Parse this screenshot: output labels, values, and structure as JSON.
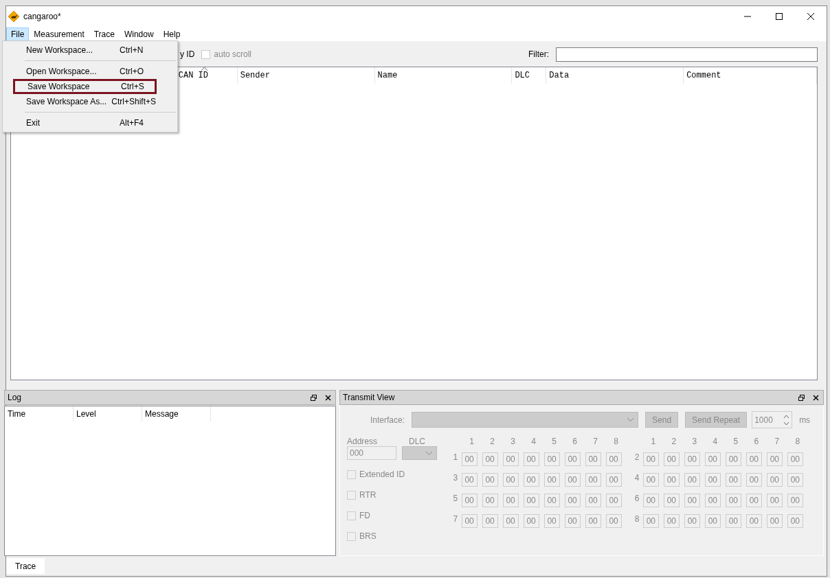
{
  "window": {
    "title": "cangaroo*"
  },
  "menubar": [
    {
      "label": "File",
      "selected": true
    },
    {
      "label": "Measurement",
      "selected": false
    },
    {
      "label": "Trace",
      "selected": false
    },
    {
      "label": "Window",
      "selected": false
    },
    {
      "label": "Help",
      "selected": false
    }
  ],
  "file_menu": {
    "items": [
      {
        "kind": "item",
        "label": "New Workspace...",
        "shortcut": "Ctrl+N",
        "highlighted": false
      },
      {
        "kind": "separator"
      },
      {
        "kind": "item",
        "label": "Open Workspace...",
        "shortcut": "Ctrl+O",
        "highlighted": false
      },
      {
        "kind": "item",
        "label": "Save Workspace",
        "shortcut": "Ctrl+S",
        "highlighted": true
      },
      {
        "kind": "item",
        "label": "Save Workspace As...",
        "shortcut": "Ctrl+Shift+S",
        "highlighted": false
      },
      {
        "kind": "separator"
      },
      {
        "kind": "item",
        "label": "Exit",
        "shortcut": "Alt+F4",
        "highlighted": false
      }
    ]
  },
  "trace_toolbar": {
    "aggregate_label": "y ID",
    "auto_scroll": {
      "label": "auto scroll",
      "checked": false
    },
    "filter_label": "Filter:"
  },
  "trace_table": {
    "columns": [
      {
        "label": "CAN ID",
        "sorted": true
      },
      {
        "label": "Sender",
        "sorted": false
      },
      {
        "label": "Name",
        "sorted": false
      },
      {
        "label": "DLC",
        "sorted": false
      },
      {
        "label": "Data",
        "sorted": false
      },
      {
        "label": "Comment",
        "sorted": false
      }
    ]
  },
  "log": {
    "title": "Log",
    "columns": [
      "Time",
      "Level",
      "Message"
    ]
  },
  "transmit": {
    "title": "Transmit View",
    "interface_label": "Interface:",
    "send": "Send",
    "send_repeat": "Send Repeat",
    "interval": "1000",
    "unit": "ms",
    "address_label": "Address",
    "address": "000",
    "dlc_label": "DLC",
    "flags": [
      {
        "label": "Extended ID",
        "checked": false
      },
      {
        "label": "RTR",
        "checked": false
      },
      {
        "label": "FD",
        "checked": false
      },
      {
        "label": "BRS",
        "checked": false
      }
    ],
    "groups": [
      {
        "headers": [
          "1",
          "2",
          "3",
          "4",
          "5",
          "6",
          "7",
          "8"
        ],
        "frames": [
          {
            "label": "1",
            "bytes": [
              "00",
              "00",
              "00",
              "00",
              "00",
              "00",
              "00",
              "00"
            ]
          },
          {
            "label": "3",
            "bytes": [
              "00",
              "00",
              "00",
              "00",
              "00",
              "00",
              "00",
              "00"
            ]
          },
          {
            "label": "5",
            "bytes": [
              "00",
              "00",
              "00",
              "00",
              "00",
              "00",
              "00",
              "00"
            ]
          },
          {
            "label": "7",
            "bytes": [
              "00",
              "00",
              "00",
              "00",
              "00",
              "00",
              "00",
              "00"
            ]
          }
        ]
      },
      {
        "headers": [
          "1",
          "2",
          "3",
          "4",
          "5",
          "6",
          "7",
          "8"
        ],
        "frames": [
          {
            "label": "2",
            "bytes": [
              "00",
              "00",
              "00",
              "00",
              "00",
              "00",
              "00",
              "00"
            ]
          },
          {
            "label": "4",
            "bytes": [
              "00",
              "00",
              "00",
              "00",
              "00",
              "00",
              "00",
              "00"
            ]
          },
          {
            "label": "6",
            "bytes": [
              "00",
              "00",
              "00",
              "00",
              "00",
              "00",
              "00",
              "00"
            ]
          },
          {
            "label": "8",
            "bytes": [
              "00",
              "00",
              "00",
              "00",
              "00",
              "00",
              "00",
              "00"
            ]
          }
        ]
      }
    ]
  },
  "bottom_tabs": [
    {
      "label": "Trace",
      "selected": true
    }
  ]
}
